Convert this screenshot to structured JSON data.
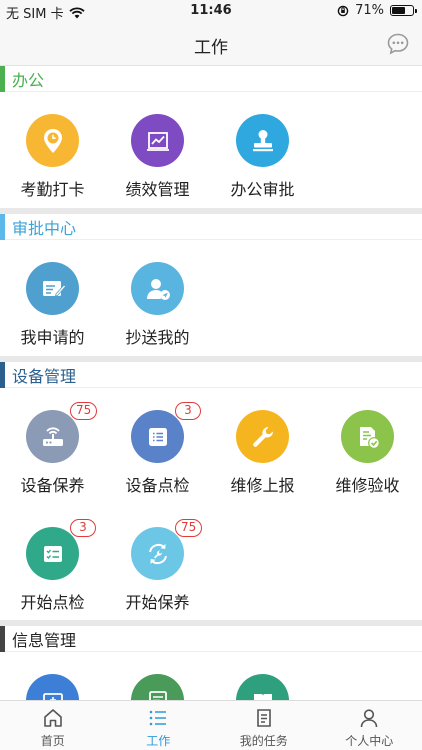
{
  "status_bar": {
    "carrier": "无 SIM 卡",
    "time": "11:46",
    "battery": "71%",
    "battery_level": 0.71
  },
  "nav": {
    "title": "工作"
  },
  "sections": {
    "office": {
      "title": "办公",
      "accent": "#4caf50",
      "title_color": "#4caf50",
      "items": [
        {
          "label": "考勤打卡",
          "icon": "location-clock-icon",
          "color": "#f7b733"
        },
        {
          "label": "绩效管理",
          "icon": "chart-icon",
          "color": "#7e4bc2"
        },
        {
          "label": "办公审批",
          "icon": "stamp-icon",
          "color": "#2fa8e0"
        }
      ]
    },
    "approval": {
      "title": "审批中心",
      "accent": "#5bb8e8",
      "title_color": "#3aa3d8",
      "items": [
        {
          "label": "我申请的",
          "icon": "edit-card-icon",
          "color": "#4fa0cf"
        },
        {
          "label": "抄送我的",
          "icon": "user-send-icon",
          "color": "#5ab4e0"
        }
      ]
    },
    "equipment": {
      "title": "设备管理",
      "accent": "#2b5f8e",
      "title_color": "#2b5f8e",
      "items": [
        {
          "label": "设备保养",
          "icon": "router-icon",
          "color": "#8b9bb6",
          "badge": "75"
        },
        {
          "label": "设备点检",
          "icon": "list-box-icon",
          "color": "#5a82c8",
          "badge": "3"
        },
        {
          "label": "维修上报",
          "icon": "wrench-icon",
          "color": "#f5b51e"
        },
        {
          "label": "维修验收",
          "icon": "doc-check-icon",
          "color": "#8cc34a"
        },
        {
          "label": "开始点检",
          "icon": "checklist-icon",
          "color": "#2fa98a",
          "badge": "3"
        },
        {
          "label": "开始保养",
          "icon": "refresh-wrench-icon",
          "color": "#6cc7e6",
          "badge": "75"
        }
      ]
    },
    "info": {
      "title": "信息管理",
      "accent": "#444444",
      "title_color": "#222222",
      "items": [
        {
          "icon": "monitor-icon",
          "color": "#3d7fd6"
        },
        {
          "icon": "form-icon",
          "color": "#4a9a5a"
        },
        {
          "icon": "book-icon",
          "color": "#2fa07e"
        }
      ]
    }
  },
  "tabs": [
    {
      "label": "首页",
      "icon": "home-icon",
      "active": false
    },
    {
      "label": "工作",
      "icon": "list-icon",
      "active": true
    },
    {
      "label": "我的任务",
      "icon": "task-doc-icon",
      "active": false
    },
    {
      "label": "个人中心",
      "icon": "person-icon",
      "active": false
    }
  ],
  "colors": {
    "tab_active": "#2d9bd6",
    "tab_inactive": "#555555",
    "badge": "#e23b3b"
  }
}
